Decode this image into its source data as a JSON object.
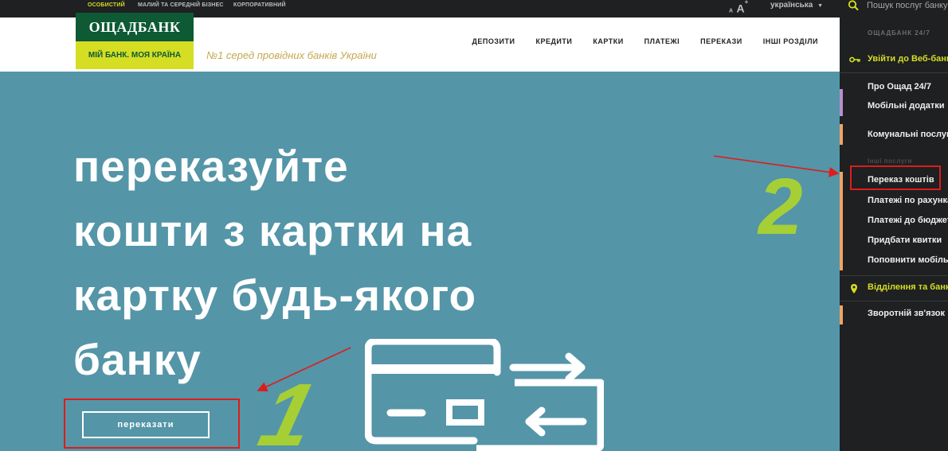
{
  "topbar": {
    "segments": [
      "особистий",
      "малий та середній бізнес",
      "корпоративний"
    ],
    "font_small": "A",
    "font_large": "A",
    "font_plus": "+",
    "language": "українська",
    "language_caret": "▼",
    "search_placeholder": "Пошук послуг банку"
  },
  "header": {
    "logo_name": "ОЩАДБАНК",
    "logo_slogan": "МІЙ БАНК. МОЯ КРАЇНА",
    "tagline": "№1 серед провідних банків України",
    "nav": [
      "депозити",
      "кредити",
      "картки",
      "платежі",
      "перекази",
      "інші розділи"
    ]
  },
  "hero": {
    "title_lines": [
      "переказуйте",
      "кошти з картки на",
      "картку будь-якого",
      "банку"
    ],
    "button_label": "переказати"
  },
  "annotations": {
    "step_one": "1",
    "step_two": "2"
  },
  "sidebar": {
    "section_title": "ОЩАДБАНК 24/7",
    "login": "Увійти до Веб-банкінгу",
    "about": "Про Ощад 24/7",
    "mobile_apps": "Мобільні додатки",
    "utilities": "Комунальні послуги",
    "other_services": "Інші послуги",
    "transfer": "Переказ коштів",
    "account_payments": "Платежі по рахунках",
    "budget_payments": "Платежі до бюджету",
    "buy_tickets": "Придбати квитки",
    "mobile_topup": "Поповнити мобільний",
    "branches": "Відділення та банкомати",
    "feedback": "Зворотній зв'язок"
  },
  "colors": {
    "lime": "#d6de23",
    "bank_green": "#0d5a35",
    "hero_teal": "#5495a8",
    "annotation_red": "#e01b1b",
    "annotation_green": "#a6cf36",
    "accent_purple": "#b98fd0",
    "accent_orange": "#f2a365"
  }
}
